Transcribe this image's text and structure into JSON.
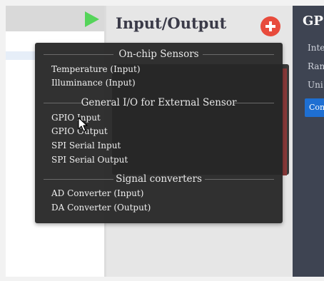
{
  "middle_pane": {
    "title": "Input/Output",
    "add_icon": "plus-circle-icon"
  },
  "left_pane": {
    "run_icon": "play-icon"
  },
  "right_pane": {
    "title": "GP",
    "labels": [
      "Inte",
      "Ran",
      "Uni"
    ],
    "button_label": "Con"
  },
  "popup_menu": {
    "groups": [
      {
        "header": "On-chip Sensors",
        "items": [
          "Temperature (Input)",
          "Illuminance (Input)"
        ]
      },
      {
        "header": "General I/O for External Sensor",
        "items": [
          "GPIO Input",
          "GPIO Output",
          "SPI Serial Input",
          "SPI Serial Output"
        ]
      },
      {
        "header": "Signal converters",
        "items": [
          "AD Converter (Input)",
          "DA Converter (Output)"
        ]
      }
    ]
  },
  "colors": {
    "add_button": "#e84b3c",
    "play_icon": "#55d45a",
    "popup_bg": "#262626",
    "right_pane_bg": "#3e4452",
    "right_button": "#1e6fd2"
  }
}
